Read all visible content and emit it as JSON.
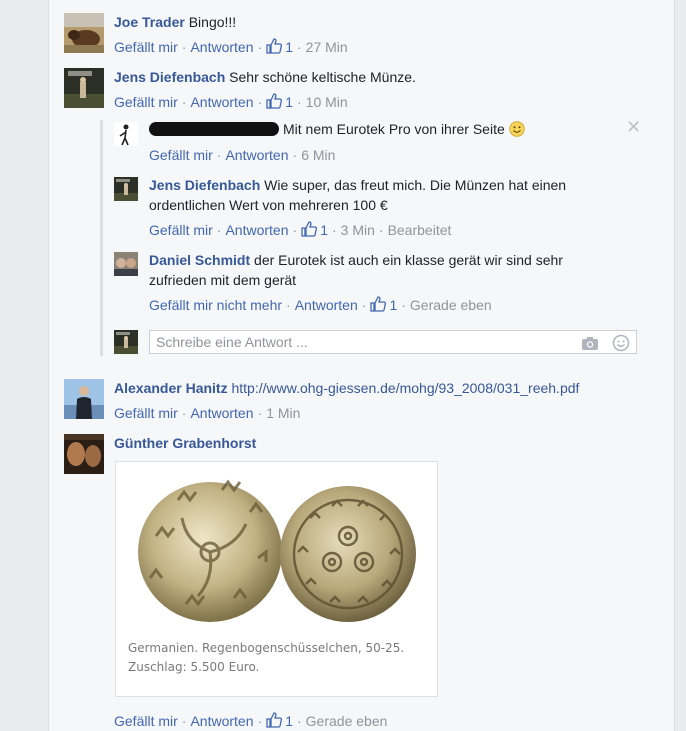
{
  "comments": [
    {
      "name": "Joe Trader",
      "text": "Bingo!!!",
      "like_label": "Gefällt mir",
      "reply_label": "Antworten",
      "likes": "1",
      "time": "27 Min"
    },
    {
      "name": "Jens Diefenbach",
      "text": "Sehr schöne keltische Münze.",
      "like_label": "Gefällt mir",
      "reply_label": "Antworten",
      "likes": "1",
      "time": "10 Min"
    }
  ],
  "replies": [
    {
      "name_redacted": true,
      "text": "Mit nem Eurotek Pro von ihrer Seite",
      "emoji": "smiley-emoji",
      "like_label": "Gefällt mir",
      "reply_label": "Antworten",
      "time": "6 Min",
      "close_icon": "close-icon"
    },
    {
      "name": "Jens Diefenbach",
      "text_line1": "Wie super, das freut mich. Die Münzen hat einen",
      "text_line2": "ordentlichen Wert von mehreren 100 €",
      "like_label": "Gefällt mir",
      "reply_label": "Antworten",
      "likes": "1",
      "time": "3 Min",
      "edited": "Bearbeitet"
    },
    {
      "name": "Daniel Schmidt",
      "text_line1": "der Eurotek ist auch ein klasse gerät wir sind sehr",
      "text_line2": "zufrieden mit dem gerät",
      "like_label": "Gefällt mir nicht mehr",
      "reply_label": "Antworten",
      "likes": "1",
      "time": "Gerade eben"
    }
  ],
  "reply_input": {
    "placeholder": "Schreibe eine Antwort ...",
    "camera_icon": "camera-icon",
    "emoji_icon": "emoji-icon"
  },
  "comment3": {
    "name": "Alexander Hanitz",
    "link": "http://www.ohg-giessen.de/mohg/93_2008/031_reeh.pdf",
    "like_label": "Gefällt mir",
    "reply_label": "Antworten",
    "time": "1 Min"
  },
  "comment4": {
    "name": "Günther Grabenhorst",
    "caption_line1": "Germanien. Regenbogenschüsselchen, 50-25.",
    "caption_line2": "Zuschlag: 5.500 Euro.",
    "like_label": "Gefällt mir",
    "reply_label": "Antworten",
    "likes": "1",
    "time": "Gerade eben"
  },
  "colors": {
    "link": "#365899",
    "action": "#4267b2",
    "meta": "#90949c",
    "panel": "#f6f7f9"
  }
}
